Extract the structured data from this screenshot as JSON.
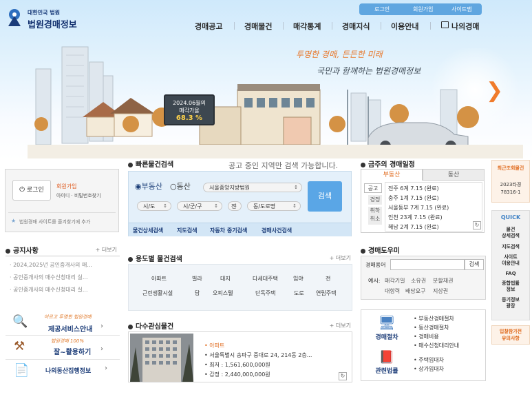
{
  "header": {
    "logo_top": "대한민국 법원",
    "logo_main": "법원경매정보",
    "utility": [
      "로그인",
      "회원가입",
      "사이트맵"
    ],
    "nav": [
      "경매공고",
      "경매물건",
      "매각통계",
      "경매지식",
      "이용안내",
      "나의경매"
    ],
    "slogan_line1": "투명한 경매, 든든한 미래",
    "slogan_line2": "국민과 함께하는 법원경매정보",
    "rate_sign": {
      "line1": "2024.06월의",
      "line2": "매각가율",
      "value": "68.3 %"
    }
  },
  "login_box": {
    "button": "로그인",
    "join": "회원가입",
    "find": "아이디 · 비밀번호찾기",
    "favorite": "법원경매 사이트를 즐겨찾기에 추가"
  },
  "quick_search": {
    "title": "빠른물건검색",
    "notice": "공고 중인 지역만 검색 가능합니다.",
    "radio_realty": "부동산",
    "radio_movable": "동산",
    "court_select": "서울중앙지방법원",
    "sido": "시/도",
    "sigungu": "시/군/구",
    "dong_hidden": "전",
    "dongro": "동/도로명",
    "search_button": "검색",
    "links": [
      "물건상세검색",
      "지도검색",
      "자동차 중기검색",
      "경매사건검색"
    ]
  },
  "schedule": {
    "title": "금주의 경매일정",
    "tabs": [
      "부동산",
      "동산"
    ],
    "side_tags": [
      "공고",
      "경정",
      "취하\n취소"
    ],
    "items": [
      "전주 6계 7.15 (완료)",
      "충주 1계 7.15 (완료)",
      "서울동부 7계 7.15 (완료)",
      "인천 23계 7.15 (완료)",
      "해남 2계 7.15 (완료)"
    ]
  },
  "right_rail": {
    "recent_title": "최근조회물건",
    "recent_item": "2023타경\n78316-1",
    "quick_title": "QUICK",
    "quick_items": [
      "물건\n상세검색",
      "지도검색",
      "사이트\n이용안내",
      "FAQ",
      "종합법률\n정보",
      "등기정보\n광장"
    ],
    "notice_btn": "입찰참가전\n유의사항"
  },
  "notice": {
    "title": "공지사항",
    "more": "더보기",
    "items": [
      "2024,2025년 공인중개사의 매...",
      "공인중개사의 매수신청대리 실...",
      "공인중개사의 매수신청대리 실..."
    ]
  },
  "banners": [
    {
      "sub": "어르고 투명한 법원경매",
      "main": "제공서비스안내"
    },
    {
      "sub": "법원경매 100%",
      "main": "잘~활용하기"
    },
    {
      "sub": "",
      "main": "나의동산집행정보"
    }
  ],
  "usage_search": {
    "title": "용도별 물건검색",
    "more": "더보기",
    "row1": [
      "아파트",
      "빌라",
      "대지",
      "다세대주택",
      "임야",
      "전"
    ],
    "row2": [
      "근린생활시설",
      "답",
      "오피스텔",
      "단독주택",
      "도로",
      "연립주택"
    ]
  },
  "popular": {
    "title": "다수관심물건",
    "more": "더보기",
    "type": "아파트",
    "address": "서울특별시 송파구 중대로 24, 214동 2층...",
    "min_price": "최저 : 1,561,600,000원",
    "appraisal": "감정 : 2,440,000,000원"
  },
  "glossary": {
    "title": "경매도우미",
    "label": "경매용어",
    "search_button": "검색",
    "example_label": "예시:",
    "examples_row1": [
      "매각기일",
      "소유권",
      "분할채권"
    ],
    "examples_row2": [
      "대항력",
      "배당요구",
      "지상권"
    ]
  },
  "procedures": {
    "left1": "경매절차",
    "left2": "관련법률",
    "list1": [
      "부동산경매절차",
      "동산경매절차",
      "경매비용",
      "매수신청대리안내"
    ],
    "list2": [
      "주택임대차",
      "상가임대차"
    ]
  },
  "colors": {
    "accent": "#5aa6e6",
    "orange": "#f07b2b",
    "navy": "#12306e"
  }
}
